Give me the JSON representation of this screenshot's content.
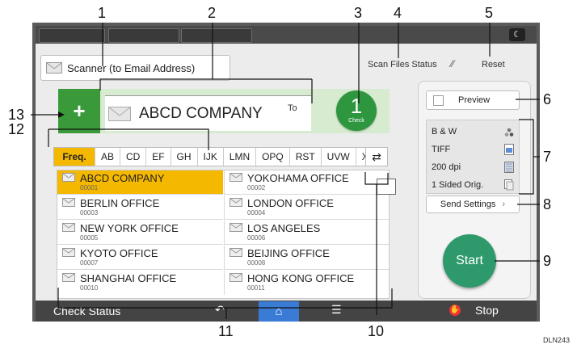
{
  "header": {
    "scan_files_status": "Scan Files Status",
    "reset": "Reset"
  },
  "mode_title": "Scanner (to Email Address)",
  "destination": {
    "add_symbol": "+",
    "selected_name": "ABCD COMPANY",
    "field_label": "To",
    "check_count": "1",
    "check_label": "Check"
  },
  "index_tabs": [
    "Freq.",
    "AB",
    "CD",
    "EF",
    "GH",
    "IJK",
    "LMN",
    "OPQ",
    "RST",
    "UVW",
    "XYZ"
  ],
  "address_book": [
    {
      "name": "ABCD COMPANY",
      "code": "00001",
      "selected": true
    },
    {
      "name": "YOKOHAMA OFFICE",
      "code": "00002"
    },
    {
      "name": "BERLIN OFFICE",
      "code": "00003"
    },
    {
      "name": "LONDON OFFICE",
      "code": "00004"
    },
    {
      "name": "NEW YORK OFFICE",
      "code": "00005"
    },
    {
      "name": "LOS ANGELES",
      "code": "00006"
    },
    {
      "name": "KYOTO OFFICE",
      "code": "00007"
    },
    {
      "name": "BEIJING OFFICE",
      "code": "00008"
    },
    {
      "name": "SHANGHAI  OFFICE",
      "code": "00010"
    },
    {
      "name": "HONG KONG OFFICE",
      "code": "00011"
    }
  ],
  "right_panel": {
    "preview": "Preview",
    "settings": [
      {
        "label": "B & W",
        "icon": "color-mode-icon"
      },
      {
        "label": "TIFF",
        "icon": "file-type-icon"
      },
      {
        "label": "200 dpi",
        "icon": "resolution-icon"
      },
      {
        "label": "1 Sided Orig.",
        "icon": "original-sides-icon"
      }
    ],
    "send_settings": "Send Settings",
    "start": "Start"
  },
  "bottom_bar": {
    "check_status": "Check Status",
    "stop": "Stop"
  },
  "callouts": [
    "1",
    "2",
    "3",
    "4",
    "5",
    "6",
    "7",
    "8",
    "9",
    "10",
    "11",
    "12",
    "13"
  ],
  "figure_id": "DLN243"
}
